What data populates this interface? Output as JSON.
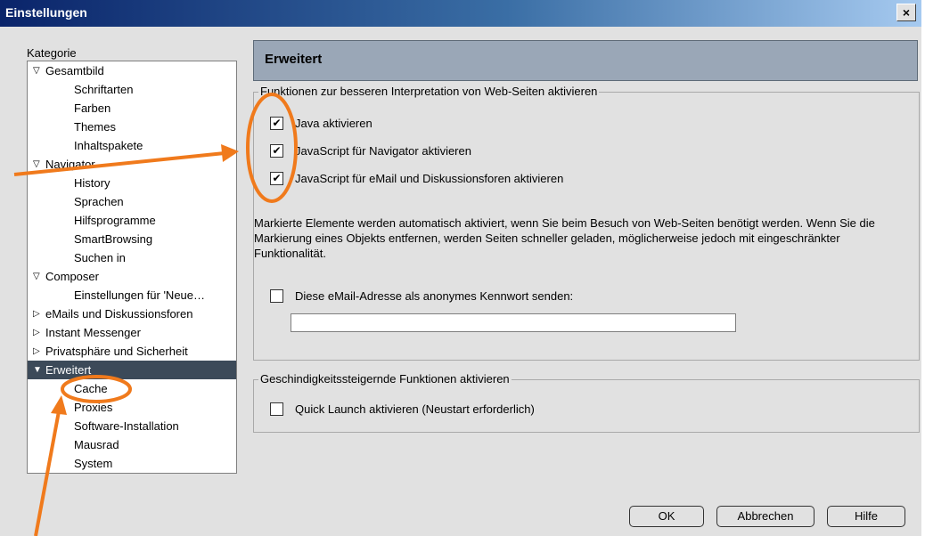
{
  "window": {
    "title": "Einstellungen",
    "close_label": "×"
  },
  "sidebar": {
    "label": "Kategorie",
    "items": [
      {
        "label": "Gesamtbild",
        "level": 0,
        "twisty": "open"
      },
      {
        "label": "Schriftarten",
        "level": 1
      },
      {
        "label": "Farben",
        "level": 1
      },
      {
        "label": "Themes",
        "level": 1
      },
      {
        "label": "Inhaltspakete",
        "level": 1
      },
      {
        "label": "Navigator",
        "level": 0,
        "twisty": "open"
      },
      {
        "label": "History",
        "level": 1
      },
      {
        "label": "Sprachen",
        "level": 1
      },
      {
        "label": "Hilfsprogramme",
        "level": 1
      },
      {
        "label": "SmartBrowsing",
        "level": 1
      },
      {
        "label": "Suchen in",
        "level": 1
      },
      {
        "label": "Composer",
        "level": 0,
        "twisty": "open"
      },
      {
        "label": "Einstellungen für 'Neue…",
        "level": 1
      },
      {
        "label": "eMails und Diskussionsforen",
        "level": 0,
        "twisty": "closed"
      },
      {
        "label": "Instant Messenger",
        "level": 0,
        "twisty": "closed"
      },
      {
        "label": "Privatsphäre und Sicherheit",
        "level": 0,
        "twisty": "closed"
      },
      {
        "label": "Erweitert",
        "level": 0,
        "twisty": "open",
        "selected": true
      },
      {
        "label": "Cache",
        "level": 1
      },
      {
        "label": "Proxies",
        "level": 1
      },
      {
        "label": "Software-Installation",
        "level": 1
      },
      {
        "label": "Mausrad",
        "level": 1
      },
      {
        "label": "System",
        "level": 1
      }
    ]
  },
  "panel": {
    "title": "Erweitert",
    "group1": {
      "legend": "Funktionen zur besseren Interpretation von Web-Seiten aktivieren",
      "checkboxes": [
        {
          "label": "Java aktivieren",
          "checked": true
        },
        {
          "label": "JavaScript für Navigator aktivieren",
          "checked": true
        },
        {
          "label": "JavaScript für eMail und Diskussionsforen aktivieren",
          "checked": true
        }
      ],
      "description": "Markierte Elemente werden automatisch aktiviert, wenn Sie beim Besuch von Web-Seiten benötigt werden. Wenn Sie die Markierung eines Objekts entfernen, werden Seiten schneller geladen, möglicherweise jedoch mit eingeschränkter Funktionalität.",
      "email_checkbox": {
        "label": "Diese eMail-Adresse als anonymes Kennwort senden:",
        "checked": false
      },
      "email_value": ""
    },
    "group2": {
      "legend": "Geschindigkeitssteigernde Funktionen aktivieren",
      "checkbox": {
        "label": "Quick Launch aktivieren (Neustart erforderlich)",
        "checked": false
      }
    }
  },
  "buttons": {
    "ok": "OK",
    "cancel": "Abbrechen",
    "help": "Hilfe"
  },
  "annotation_color": "#f07a1c",
  "icons": {
    "checked_glyph": "✔",
    "twisty_open": "▽",
    "twisty_closed": "▷",
    "twisty_selected": "▼"
  }
}
